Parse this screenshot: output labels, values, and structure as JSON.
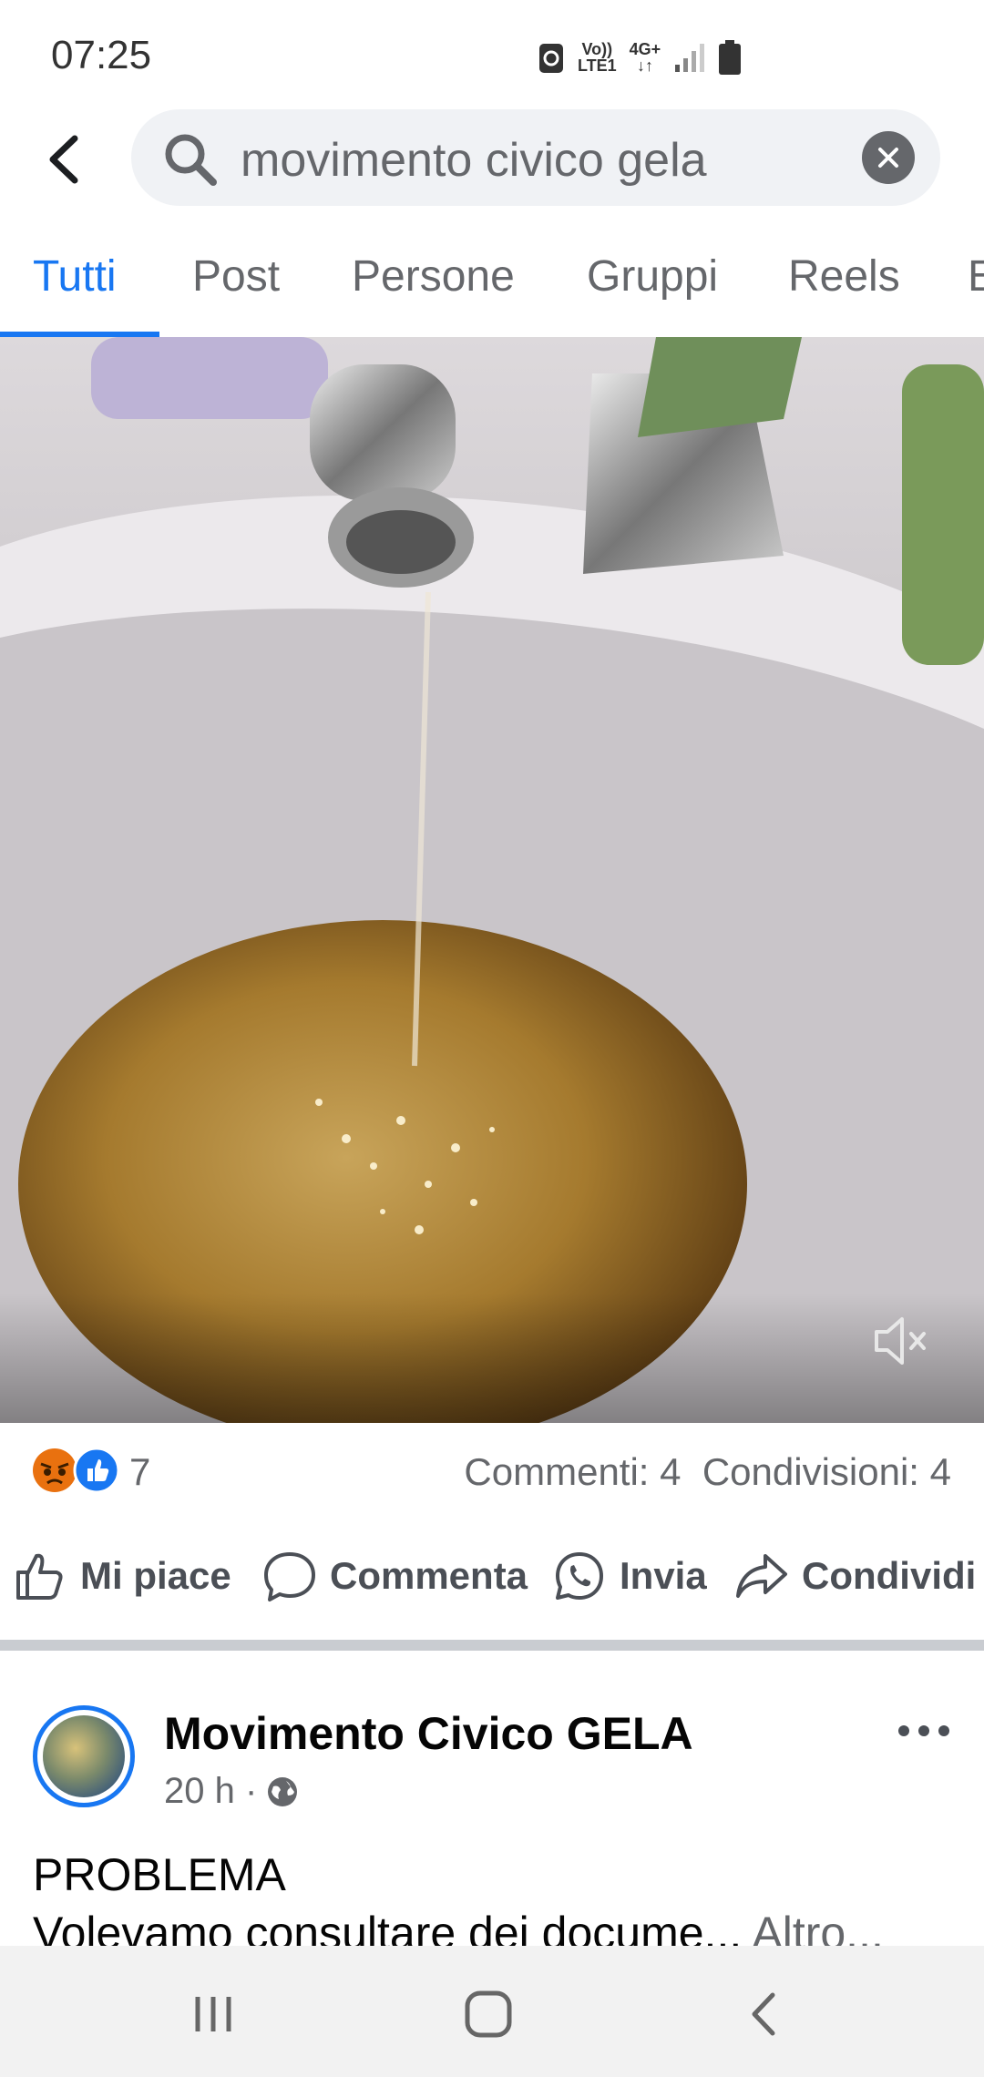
{
  "status_bar": {
    "time": "07:25",
    "network_line1": "Vo))",
    "network_line2": "LTE1",
    "network_type": "4G+"
  },
  "search": {
    "query": "movimento civico gela"
  },
  "tabs": [
    "Tutti",
    "Post",
    "Persone",
    "Gruppi",
    "Reels",
    "E"
  ],
  "post_stats": {
    "reaction_count": "7",
    "comments": "Commenti: 4",
    "shares": "Condivisioni: 4"
  },
  "actions": {
    "like": "Mi piace",
    "comment": "Commenta",
    "send": "Invia",
    "share": "Condividi"
  },
  "post": {
    "author": "Movimento Civico GELA",
    "time": "20 h ·",
    "title": "PROBLEMA",
    "preview": "Volevamo consultare dei docume...",
    "more": " Altro..."
  },
  "colors": {
    "accent": "#1877f2",
    "muted_text": "#65676b"
  }
}
